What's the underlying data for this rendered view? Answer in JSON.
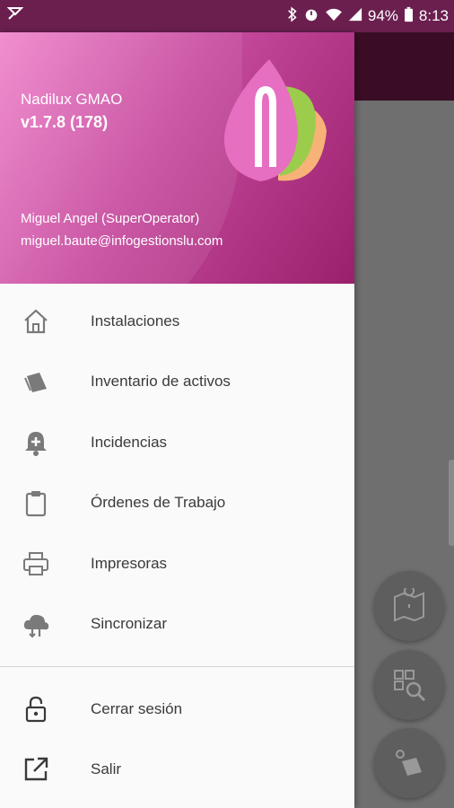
{
  "status_bar": {
    "battery": "94%",
    "time": "8:13",
    "icons": [
      "notification-icon",
      "bluetooth-icon",
      "alarm-icon",
      "wifi-icon",
      "signal-icon",
      "battery-icon"
    ]
  },
  "drawer": {
    "header": {
      "app_name": "Nadilux GMAO",
      "version": "v1.7.8 (178)",
      "user_name": "Miguel Angel (SuperOperator)",
      "user_email": "miguel.baute@infogestionslu.com"
    },
    "items": [
      {
        "label": "Instalaciones",
        "icon": "home-icon"
      },
      {
        "label": "Inventario de activos",
        "icon": "tag-icon"
      },
      {
        "label": "Incidencias",
        "icon": "bell-plus-icon"
      },
      {
        "label": "Órdenes de Trabajo",
        "icon": "clipboard-icon"
      },
      {
        "label": "Impresoras",
        "icon": "printer-icon"
      },
      {
        "label": "Sincronizar",
        "icon": "cloud-sync-icon"
      }
    ],
    "account_items": [
      {
        "label": "Cerrar sesión",
        "icon": "lock-open-icon"
      },
      {
        "label": "Salir",
        "icon": "open-external-icon"
      }
    ]
  },
  "fabs": [
    {
      "icon": "map-location-icon"
    },
    {
      "icon": "qr-search-icon"
    },
    {
      "icon": "tag-location-icon"
    }
  ],
  "colors": {
    "status_bar": "#6b1f4f",
    "header_start": "#f086cc",
    "header_end": "#9a1f6b",
    "toolbar_dark": "#3a0d25"
  }
}
